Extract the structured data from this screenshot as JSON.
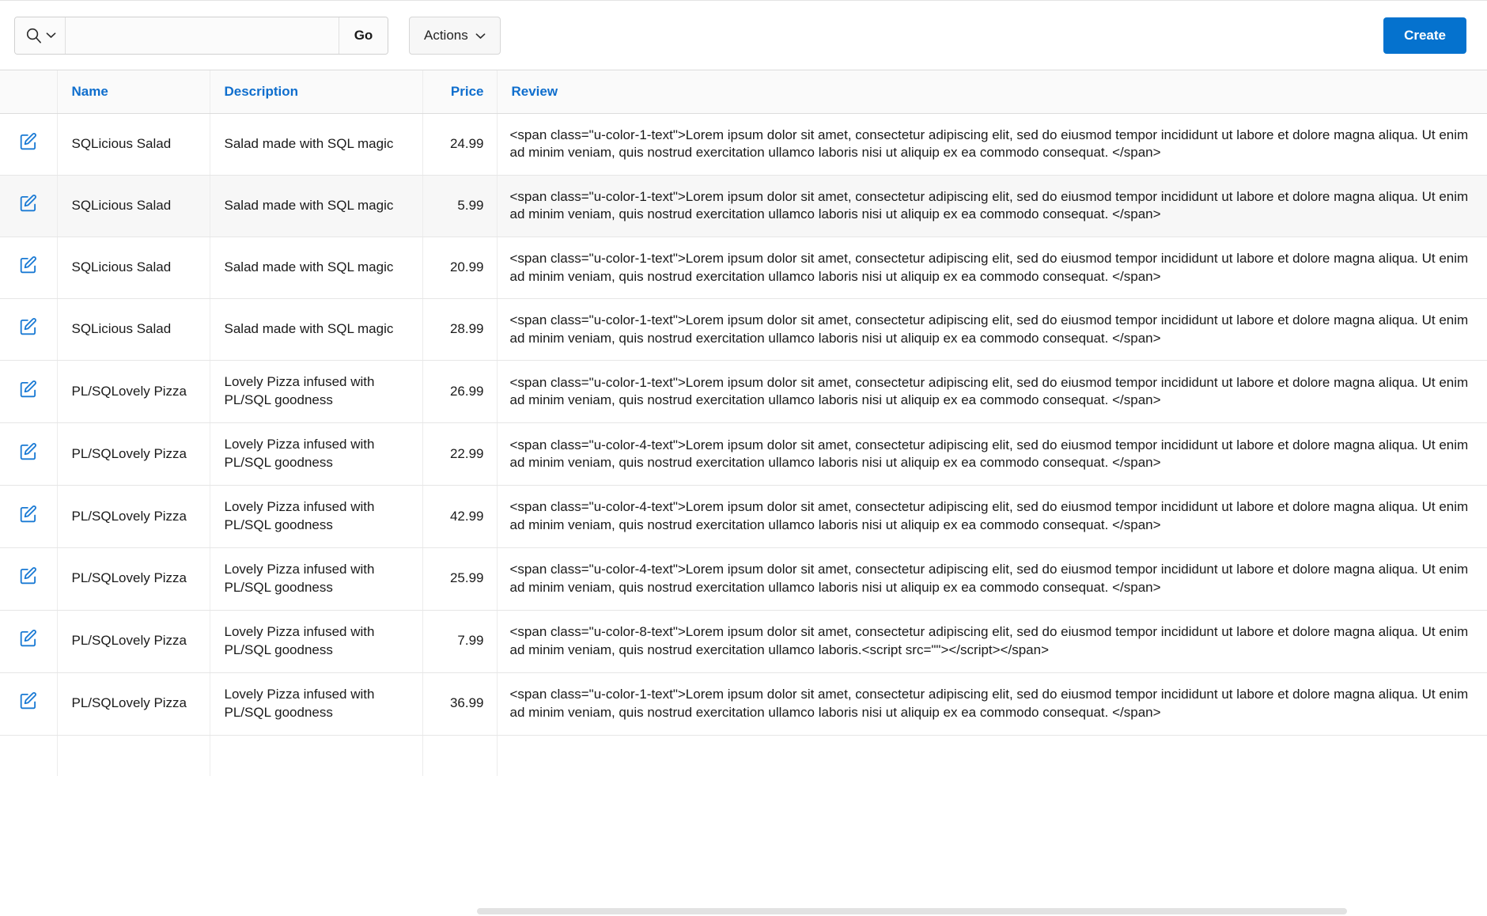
{
  "toolbar": {
    "search_placeholder": "",
    "search_value": "",
    "search_selector_icon": "search-icon",
    "go_label": "Go",
    "actions_label": "Actions",
    "create_label": "Create",
    "accent_color": "#0572ce",
    "link_color": "#0f6ecd"
  },
  "table": {
    "columns": [
      {
        "key": "edit",
        "label": "",
        "align": "center"
      },
      {
        "key": "name",
        "label": "Name",
        "align": "left"
      },
      {
        "key": "description",
        "label": "Description",
        "align": "left"
      },
      {
        "key": "price",
        "label": "Price",
        "align": "right"
      },
      {
        "key": "review",
        "label": "Review",
        "align": "left"
      }
    ],
    "rows": [
      {
        "edit_icon": "edit-pencil-icon",
        "name": "SQLicious Salad",
        "description": "Salad made with SQL magic",
        "price": "24.99",
        "review": "<span class=\"u-color-1-text\">Lorem ipsum dolor sit amet, consectetur adipiscing elit, sed do eiusmod tempor incididunt ut labore et dolore magna aliqua. Ut enim ad minim veniam, quis nostrud exercitation ullamco laboris nisi ut aliquip ex ea commodo consequat. </span>",
        "highlight": false
      },
      {
        "edit_icon": "edit-pencil-icon",
        "name": "SQLicious Salad",
        "description": "Salad made with SQL magic",
        "price": "5.99",
        "review": "<span class=\"u-color-1-text\">Lorem ipsum dolor sit amet, consectetur adipiscing elit, sed do eiusmod tempor incididunt ut labore et dolore magna aliqua. Ut enim ad minim veniam, quis nostrud exercitation ullamco laboris nisi ut aliquip ex ea commodo consequat. </span>",
        "highlight": true
      },
      {
        "edit_icon": "edit-pencil-icon",
        "name": "SQLicious Salad",
        "description": "Salad made with SQL magic",
        "price": "20.99",
        "review": "<span class=\"u-color-1-text\">Lorem ipsum dolor sit amet, consectetur adipiscing elit, sed do eiusmod tempor incididunt ut labore et dolore magna aliqua. Ut enim ad minim veniam, quis nostrud exercitation ullamco laboris nisi ut aliquip ex ea commodo consequat. </span>",
        "highlight": false
      },
      {
        "edit_icon": "edit-pencil-icon",
        "name": "SQLicious Salad",
        "description": "Salad made with SQL magic",
        "price": "28.99",
        "review": "<span class=\"u-color-1-text\">Lorem ipsum dolor sit amet, consectetur adipiscing elit, sed do eiusmod tempor incididunt ut labore et dolore magna aliqua. Ut enim ad minim veniam, quis nostrud exercitation ullamco laboris nisi ut aliquip ex ea commodo consequat. </span>",
        "highlight": false
      },
      {
        "edit_icon": "edit-pencil-icon",
        "name": "PL/SQLovely Pizza",
        "description": "Lovely Pizza infused with PL/SQL goodness",
        "price": "26.99",
        "review": "<span class=\"u-color-1-text\">Lorem ipsum dolor sit amet, consectetur adipiscing elit, sed do eiusmod tempor incididunt ut labore et dolore magna aliqua. Ut enim ad minim veniam, quis nostrud exercitation ullamco laboris nisi ut aliquip ex ea commodo consequat. </span>",
        "highlight": false
      },
      {
        "edit_icon": "edit-pencil-icon",
        "name": "PL/SQLovely Pizza",
        "description": "Lovely Pizza infused with PL/SQL goodness",
        "price": "22.99",
        "review": "<span class=\"u-color-4-text\">Lorem ipsum dolor sit amet, consectetur adipiscing elit, sed do eiusmod tempor incididunt ut labore et dolore magna aliqua. Ut enim ad minim veniam, quis nostrud exercitation ullamco laboris nisi ut aliquip ex ea commodo consequat. </span>",
        "highlight": false
      },
      {
        "edit_icon": "edit-pencil-icon",
        "name": "PL/SQLovely Pizza",
        "description": "Lovely Pizza infused with PL/SQL goodness",
        "price": "42.99",
        "review": "<span class=\"u-color-4-text\">Lorem ipsum dolor sit amet, consectetur adipiscing elit, sed do eiusmod tempor incididunt ut labore et dolore magna aliqua. Ut enim ad minim veniam, quis nostrud exercitation ullamco laboris nisi ut aliquip ex ea commodo consequat. </span>",
        "highlight": false
      },
      {
        "edit_icon": "edit-pencil-icon",
        "name": "PL/SQLovely Pizza",
        "description": "Lovely Pizza infused with PL/SQL goodness",
        "price": "25.99",
        "review": "<span class=\"u-color-4-text\">Lorem ipsum dolor sit amet, consectetur adipiscing elit, sed do eiusmod tempor incididunt ut labore et dolore magna aliqua. Ut enim ad minim veniam, quis nostrud exercitation ullamco laboris nisi ut aliquip ex ea commodo consequat. </span>",
        "highlight": false
      },
      {
        "edit_icon": "edit-pencil-icon",
        "name": "PL/SQLovely Pizza",
        "description": "Lovely Pizza infused with PL/SQL goodness",
        "price": "7.99",
        "review": "<span class=\"u-color-8-text\">Lorem ipsum dolor sit amet, consectetur adipiscing elit, sed do eiusmod tempor incididunt ut labore et dolore magna aliqua. Ut enim ad minim veniam, quis nostrud exercitation ullamco laboris.<script src=\"\"></script></span>",
        "highlight": false
      },
      {
        "edit_icon": "edit-pencil-icon",
        "name": "PL/SQLovely Pizza",
        "description": "Lovely Pizza infused with PL/SQL goodness",
        "price": "36.99",
        "review": "<span class=\"u-color-1-text\">Lorem ipsum dolor sit amet, consectetur adipiscing elit, sed do eiusmod tempor incididunt ut labore et dolore magna aliqua. Ut enim ad minim veniam, quis nostrud exercitation ullamco laboris nisi ut aliquip ex ea commodo consequat. </span>",
        "highlight": false
      }
    ]
  }
}
